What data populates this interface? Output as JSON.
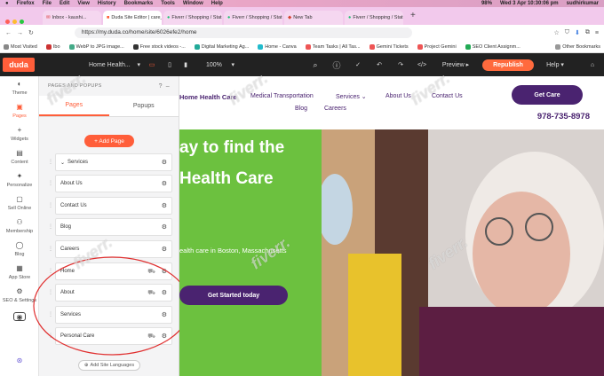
{
  "os_menu": {
    "items": [
      "Firefox",
      "File",
      "Edit",
      "View",
      "History",
      "Bookmarks",
      "Tools",
      "Window",
      "Help"
    ],
    "battery": "98%",
    "clock": "Wed 3 Apr  10:30:06 pm",
    "user": "sudhirkumar"
  },
  "browser": {
    "tabs": [
      "Inbox - kaushi...",
      "Duda Site Editor | care_rei...",
      "Fiverr / Shopping / Status",
      "Fiverr / Shopping / Status",
      "New Tab",
      "Fiverr / Shopping / Status"
    ],
    "url": "https://my.duda.co/home/site/6026efe2/home",
    "bookmarks": [
      "Most Visited",
      "Ibo",
      "WebP to JPG image...",
      "Free stock videos -...",
      "Digital Marketing Ag...",
      "Home - Canva",
      "Team Tasks | All Tas...",
      "Gemini Tickets",
      "Project Gemini",
      "SEO Client Assignm...",
      "Other Bookmarks"
    ]
  },
  "editor": {
    "logo": "duda",
    "page_select": "Home Health...",
    "zoom": "100%",
    "preview": "Preview",
    "republish": "Republish",
    "help": "Help"
  },
  "leftnav": [
    {
      "label": "Theme",
      "icon": "theme-icon"
    },
    {
      "label": "Pages",
      "icon": "pages-icon",
      "active": true
    },
    {
      "label": "Widgets",
      "icon": "widgets-icon"
    },
    {
      "label": "Content",
      "icon": "content-icon"
    },
    {
      "label": "Personalize",
      "icon": "personalize-icon"
    },
    {
      "label": "Sell Online",
      "icon": "sell-online-icon"
    },
    {
      "label": "Membership",
      "icon": "membership-icon"
    },
    {
      "label": "Blog",
      "icon": "blog-icon"
    },
    {
      "label": "App Store",
      "icon": "app-store-icon"
    },
    {
      "label": "SEO & Settings",
      "icon": "seo-settings-icon"
    }
  ],
  "panel": {
    "header": "PAGES AND POPUPS",
    "tabs": [
      "Pages",
      "Popups"
    ],
    "add_page": "+ Add Page",
    "pages": [
      "Services",
      "About Us",
      "Contact Us",
      "Blog",
      "Careers",
      "Home",
      "About",
      "Services",
      "Personal Care"
    ],
    "add_languages": "Add Site Languages"
  },
  "site": {
    "brand": "Home Health Care",
    "nav": [
      "Medical Transportation",
      "Services",
      "About Us",
      "Contact Us",
      "Blog",
      "Careers"
    ],
    "cta": "Get Care",
    "phone": "978-735-8978",
    "hero_line1": "ay to find the",
    "hero_line2": "Health Care",
    "hero_sub": "ealth care in Boston, Massachusetts",
    "hero_button": "Get Started today"
  },
  "watermark": "fiverr."
}
